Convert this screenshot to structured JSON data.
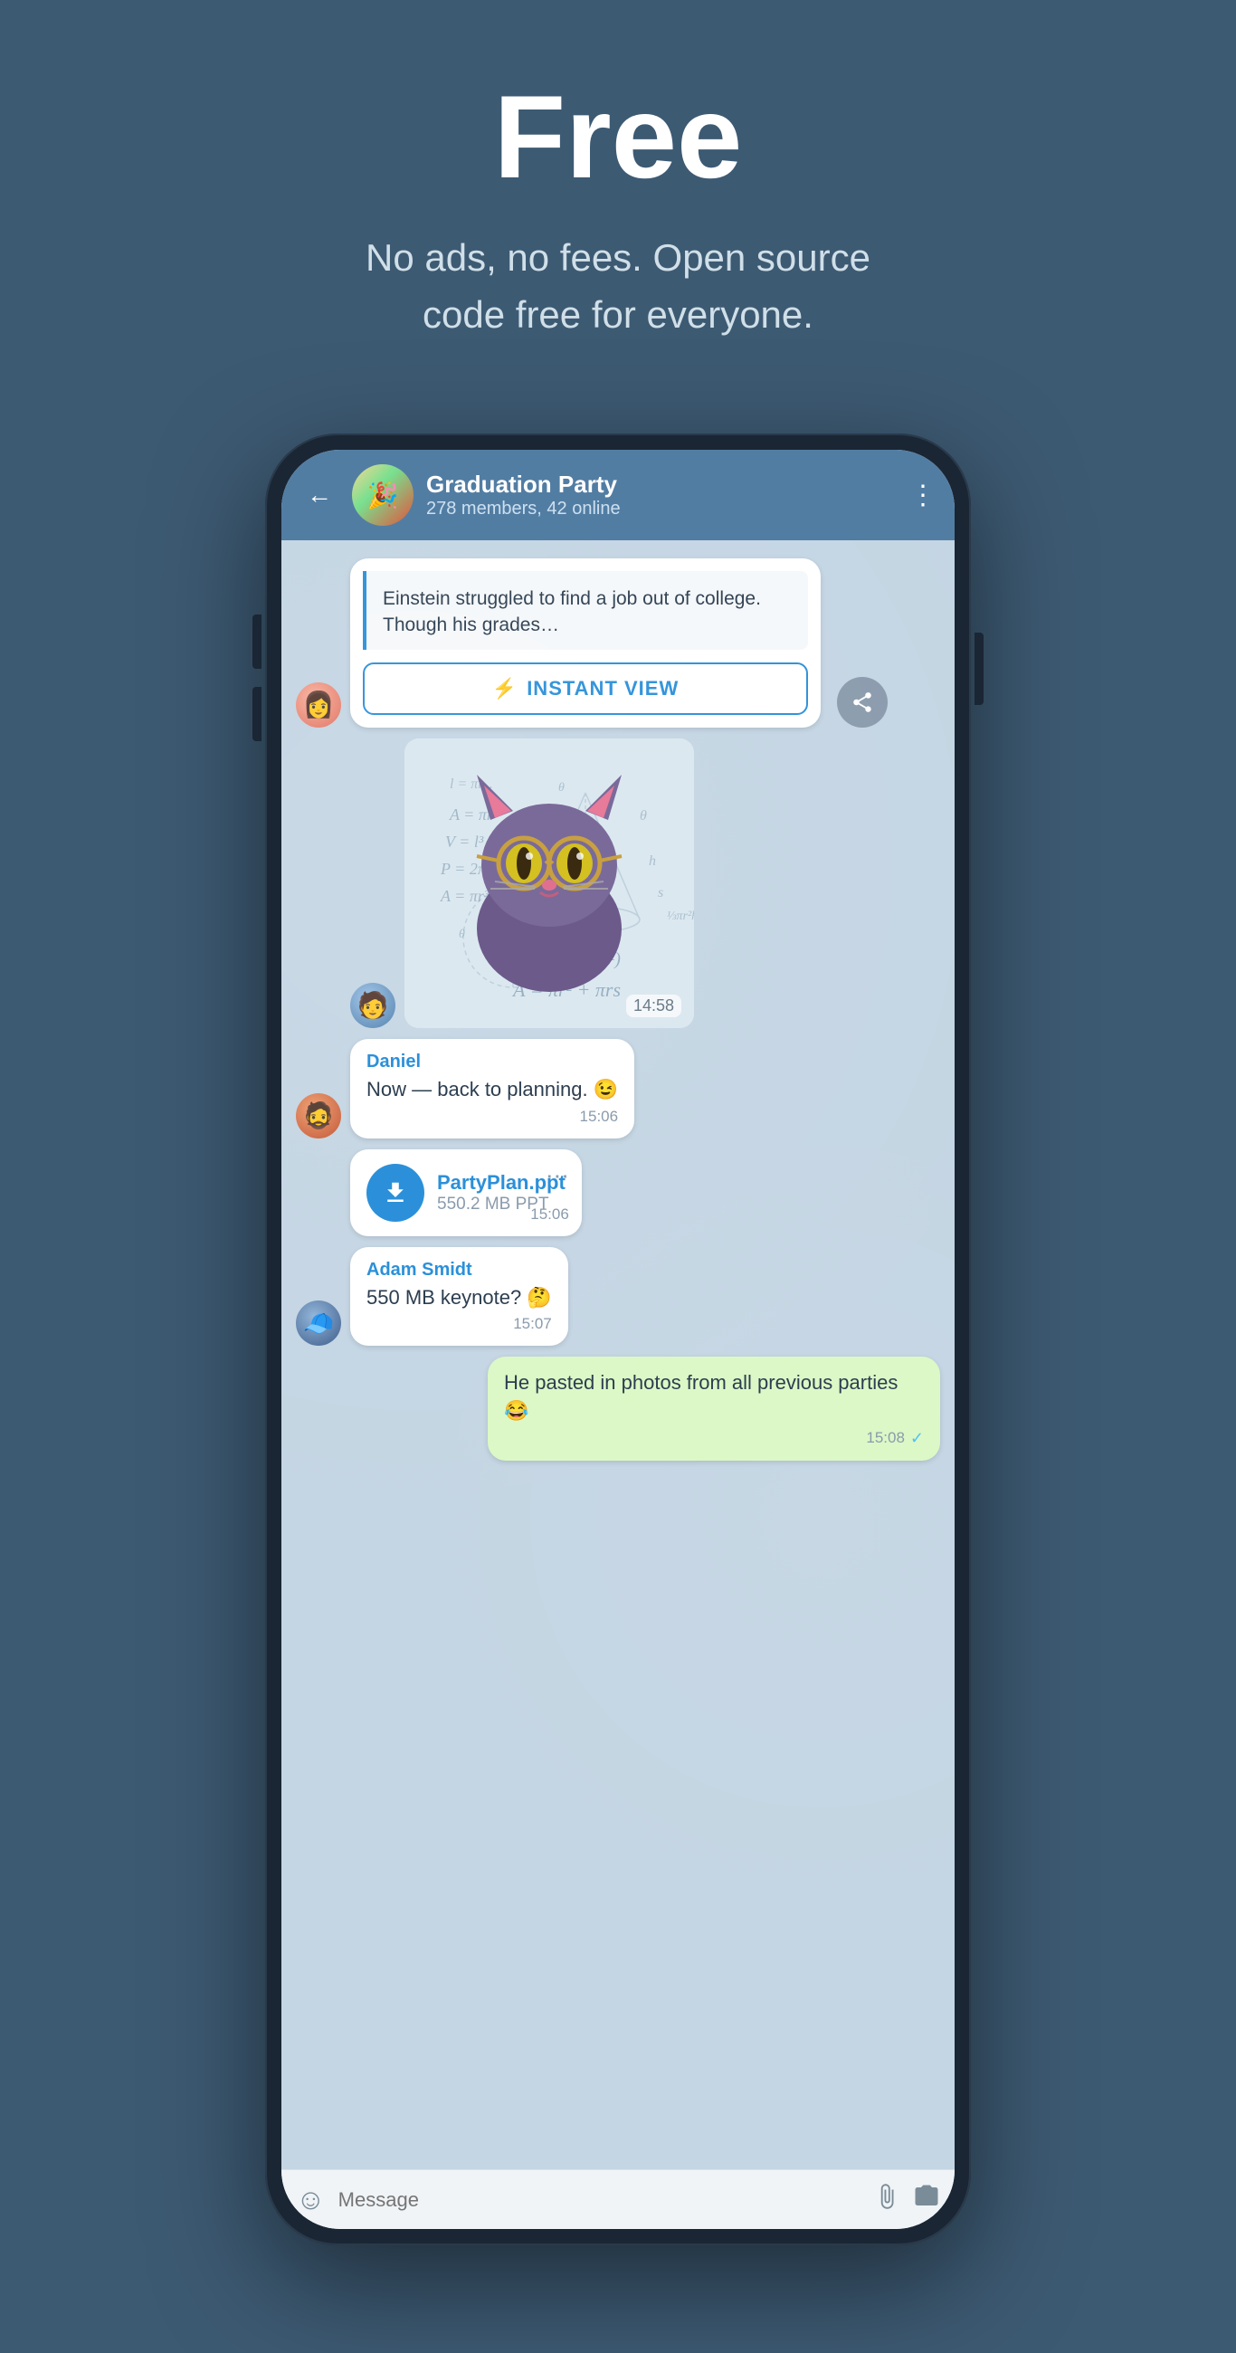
{
  "hero": {
    "title": "Free",
    "subtitle_line1": "No ads, no fees. Open source",
    "subtitle_line2": "code free for everyone."
  },
  "phone": {
    "header": {
      "chat_name": "Graduation Party",
      "chat_meta": "278 members, 42 online",
      "back_label": "←",
      "more_label": "⋮"
    },
    "messages": [
      {
        "id": "article-msg",
        "type": "article",
        "text": "Einstein struggled to find a job out of college. Though his grades…",
        "iv_label": "INSTANT VIEW",
        "iv_icon": "⚡"
      },
      {
        "id": "sticker-msg",
        "type": "sticker",
        "time": "14:58"
      },
      {
        "id": "daniel-msg",
        "type": "text",
        "sender": "Daniel",
        "text": "Now — back to planning. 😉",
        "time": "15:06"
      },
      {
        "id": "file-msg",
        "type": "file",
        "file_name": "PartyPlan.ppt",
        "file_size": "550.2 MB PPT",
        "time": "15:06"
      },
      {
        "id": "adam-msg",
        "type": "text",
        "sender": "Adam Smidt",
        "text": "550 MB keynote? 🤔",
        "time": "15:07"
      },
      {
        "id": "outgoing-msg",
        "type": "text_outgoing",
        "text": "He pasted in photos from all previous parties 😂",
        "time": "15:08",
        "check": "✓"
      }
    ],
    "input_bar": {
      "placeholder": "Message"
    }
  }
}
